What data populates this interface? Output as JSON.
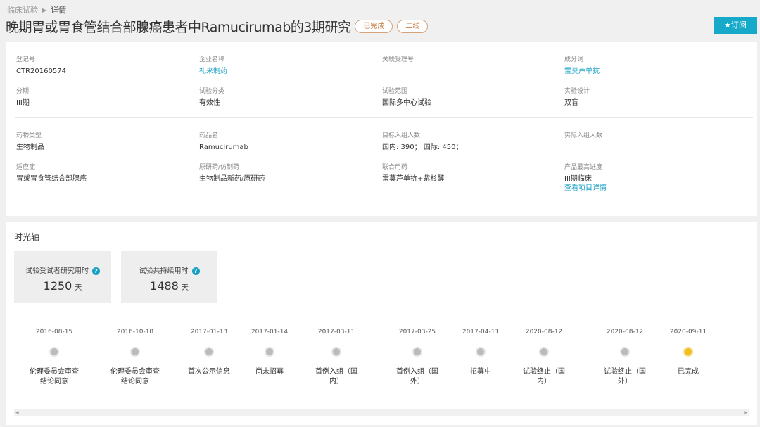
{
  "breadcrumb": {
    "root": "临床试验",
    "current": "详情"
  },
  "title": "晚期胃或胃食管结合部腺癌患者中Ramucirumab的3期研究",
  "tags": [
    "已完成",
    "二线"
  ],
  "subscribe_label": "★订阅",
  "fields": [
    {
      "label": "登记号",
      "value": "CTR20160574"
    },
    {
      "label": "企业名称",
      "value": "礼来制药",
      "link": true
    },
    {
      "label": "关联受理号",
      "value": ""
    },
    {
      "label": "成分词",
      "value": "雷莫芦单抗",
      "link": true
    },
    {
      "label": "分期",
      "value": "III期"
    },
    {
      "label": "试验分类",
      "value": "有效性"
    },
    {
      "label": "试验范围",
      "value": "国际多中心试验"
    },
    {
      "label": "实验设计",
      "value": "双盲"
    },
    {
      "label": "药物类型",
      "value": "生物制品"
    },
    {
      "label": "药品名",
      "value": "Ramucirumab"
    },
    {
      "label": "目标入组人数",
      "value": "国内: 390； 国际: 450；"
    },
    {
      "label": "实际入组人数",
      "value": ""
    },
    {
      "label": "适应症",
      "value": "胃或胃食管结合部腺癌"
    },
    {
      "label": "原研药/仿制药",
      "value": "生物制品新药/原研药"
    },
    {
      "label": "联合用药",
      "value": "雷莫芦单抗+紫杉醇"
    },
    {
      "label": "产品最高进度",
      "value": "III期临床",
      "extra_link": "查看项目详情"
    }
  ],
  "timeline": {
    "title": "时光轴",
    "stats": [
      {
        "label": "试验受试者研究用时",
        "value": "1250",
        "unit": "天"
      },
      {
        "label": "试验共持续用时",
        "value": "1488",
        "unit": "天"
      }
    ],
    "events": [
      {
        "date": "2016-08-15",
        "label": "伦理委员会审查结论同意",
        "status": "past"
      },
      {
        "date": "2016-10-18",
        "label": "伦理委员会审查结论同意",
        "status": "past"
      },
      {
        "date": "2017-01-13",
        "label": "首次公示信息",
        "status": "past"
      },
      {
        "date": "2017-01-14",
        "label": "尚未招募",
        "status": "past"
      },
      {
        "date": "2017-03-11",
        "label": "首例入组（国内）",
        "status": "past"
      },
      {
        "date": "2017-03-25",
        "label": "首例入组（国外）",
        "status": "past"
      },
      {
        "date": "2017-04-11",
        "label": "招募中",
        "status": "past"
      },
      {
        "date": "2020-08-12",
        "label": "试验终止（国内）",
        "status": "past"
      },
      {
        "date": "2020-08-12",
        "label": "试验终止（国外）",
        "status": "past"
      },
      {
        "date": "2020-09-11",
        "label": "已完成",
        "status": "done"
      }
    ]
  }
}
